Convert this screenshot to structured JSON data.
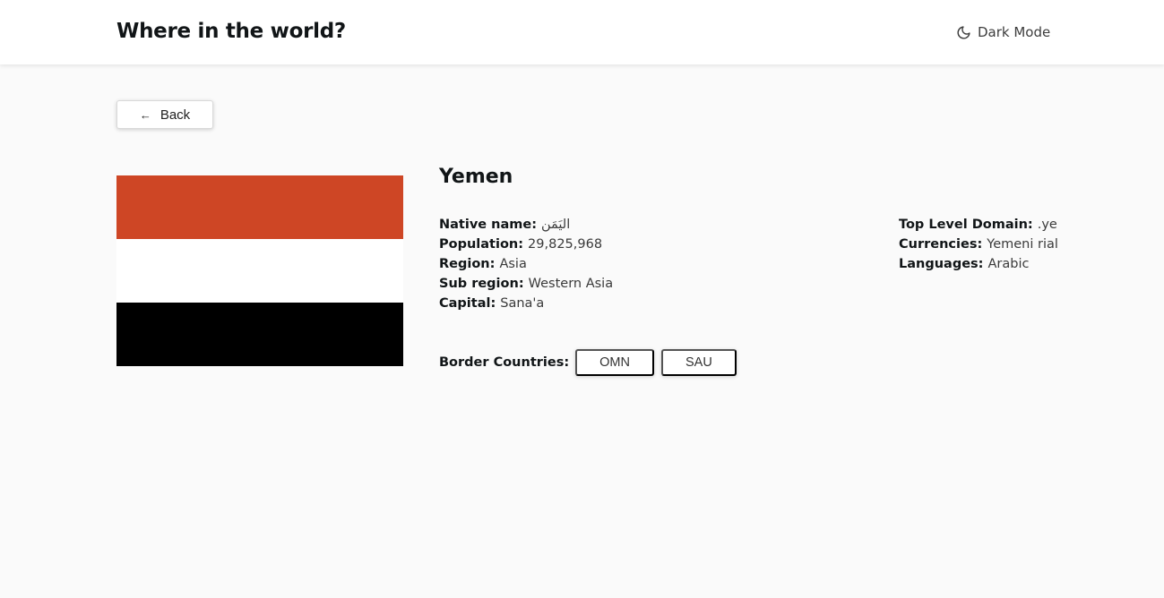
{
  "header": {
    "title": "Where in the world?",
    "dark_mode_label": "Dark Mode",
    "dark_mode_icon": "moon-icon"
  },
  "back_button": {
    "label": "Back",
    "icon": "arrow-left-icon",
    "arrow_glyph": "←"
  },
  "country": {
    "name": "Yemen",
    "flag_colors": [
      "#ce4625",
      "#ffffff",
      "#000000"
    ],
    "details_left": [
      {
        "label": "Native name:",
        "value": "اليَمَن"
      },
      {
        "label": "Population:",
        "value": "29,825,968"
      },
      {
        "label": "Region:",
        "value": "Asia"
      },
      {
        "label": "Sub region:",
        "value": "Western Asia"
      },
      {
        "label": "Capital:",
        "value": "Sana'a"
      }
    ],
    "details_right": [
      {
        "label": "Top Level Domain:",
        "value": ".ye"
      },
      {
        "label": "Currencies:",
        "value": "Yemeni rial"
      },
      {
        "label": "Languages:",
        "value": "Arabic"
      }
    ],
    "border_label": "Border Countries:",
    "border_countries": [
      "OMN",
      "SAU"
    ]
  }
}
